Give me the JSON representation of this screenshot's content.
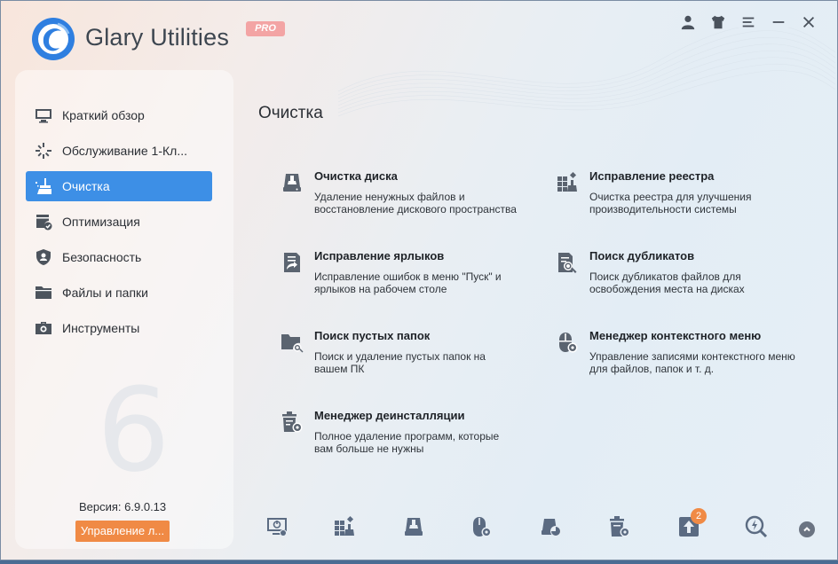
{
  "app": {
    "name": "Glary Utilities",
    "badge": "PRO"
  },
  "window_controls": [
    "user-icon",
    "shirt-icon",
    "menu-icon",
    "minimize-icon",
    "close-icon"
  ],
  "sidebar": {
    "items": [
      {
        "label": "Краткий обзор",
        "icon": "monitor-icon",
        "active": false
      },
      {
        "label": "Обслуживание 1-Кл...",
        "icon": "sparkle-icon",
        "active": false
      },
      {
        "label": "Очистка",
        "icon": "broom-icon",
        "active": true
      },
      {
        "label": "Оптимизация",
        "icon": "optimize-icon",
        "active": false
      },
      {
        "label": "Безопасность",
        "icon": "shield-icon",
        "active": false
      },
      {
        "label": "Файлы и папки",
        "icon": "folder-icon",
        "active": false
      },
      {
        "label": "Инструменты",
        "icon": "toolbox-icon",
        "active": false
      }
    ],
    "version": "Версия: 6.9.0.13",
    "manage_button": "Управление л...",
    "watermark": "6"
  },
  "main": {
    "title": "Очистка",
    "tools": [
      {
        "title": "Очистка диска",
        "desc": "Удаление ненужных файлов и восстановление дискового пространства",
        "icon": "disk-cleanup-icon"
      },
      {
        "title": "Исправление реестра",
        "desc": "Очистка реестра для улучшения производительности системы",
        "icon": "registry-icon"
      },
      {
        "title": "Исправление ярлыков",
        "desc": "Исправление ошибок в меню \"Пуск\" и ярлыков на рабочем столе",
        "icon": "shortcut-icon"
      },
      {
        "title": "Поиск дубликатов",
        "desc": "Поиск дубликатов файлов для освобождения места на дисках",
        "icon": "duplicate-icon"
      },
      {
        "title": "Поиск пустых папок",
        "desc": "Поиск и удаление пустых папок на вашем ПК",
        "icon": "empty-folder-icon"
      },
      {
        "title": "Менеджер контекстного меню",
        "desc": "Управление записями контекстного меню для файлов, папок и т. д.",
        "icon": "context-menu-icon"
      },
      {
        "title": "Менеджер деинсталляции",
        "desc": "Полное удаление программ, которые вам больше не нужны",
        "icon": "uninstall-icon"
      }
    ]
  },
  "bottombar": {
    "icons": [
      "startup-icon",
      "registry-icon",
      "disk-icon",
      "mouse-settings-icon",
      "disk-chart-icon",
      "clipboard-settings-icon",
      "update-icon",
      "search-fix-icon"
    ],
    "update_badge": "2"
  },
  "colors": {
    "accent": "#3d8fe6",
    "orange": "#f08a45",
    "pro_badge": "#f3a4a4"
  }
}
